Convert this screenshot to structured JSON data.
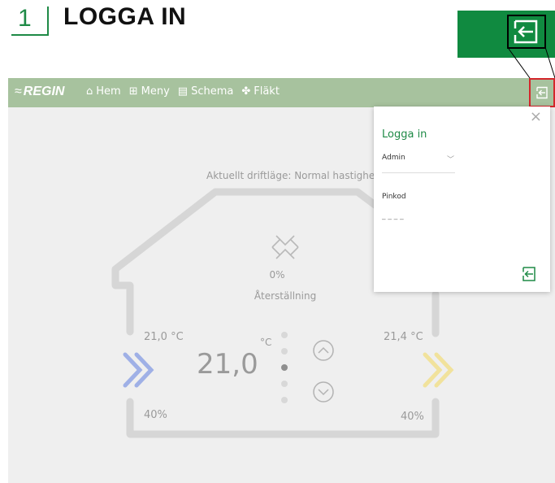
{
  "heading": {
    "number": "1",
    "title": "LOGGA IN"
  },
  "app": {
    "logo": "REGIN",
    "nav": [
      {
        "label": "Hem",
        "icon": "home-icon"
      },
      {
        "label": "Meny",
        "icon": "menu-grid-icon"
      },
      {
        "label": "Schema",
        "icon": "calendar-icon"
      },
      {
        "label": "Fläkt",
        "icon": "fan-icon"
      }
    ],
    "mode_text": "Aktuellt driftläge: Normal hastighet",
    "fan_percent": "0%",
    "reset_label": "Återställning",
    "temp_left": "21,0 °C",
    "temp_right": "21,4 °C",
    "humidity_left": "40%",
    "humidity_right": "40%",
    "setpoint": "21,0",
    "setpoint_unit": "°C"
  },
  "login": {
    "title": "Logga in",
    "user": "Admin",
    "pin_label": "Pinkod",
    "pin_placeholder": "_ _ _ _"
  },
  "colors": {
    "brand_green": "#108a40",
    "bar_green": "#a7c29e",
    "highlight_red": "#d4262b"
  }
}
